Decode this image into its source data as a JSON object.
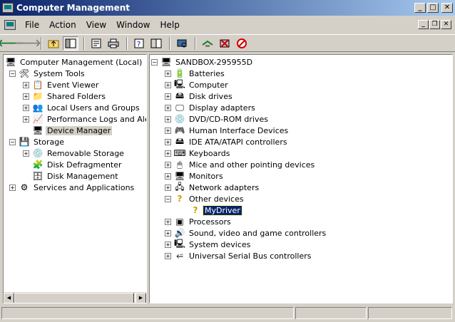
{
  "window": {
    "title": "Computer Management"
  },
  "menu": [
    "File",
    "Action",
    "View",
    "Window",
    "Help"
  ],
  "toolbar": {
    "buttons": [
      "back-icon",
      "forward-icon",
      "up-folder-icon",
      "show-hide-tree-icon",
      "properties-icon",
      "print-icon",
      "help-icon",
      "console-icon",
      "scan-hardware-icon",
      "update-driver-icon",
      "uninstall-icon",
      "disable-icon"
    ]
  },
  "left_tree": {
    "root": "Computer Management (Local)",
    "system_tools": "System Tools",
    "event_viewer": "Event Viewer",
    "shared_folders": "Shared Folders",
    "local_users": "Local Users and Groups",
    "perf_logs": "Performance Logs and Alerts",
    "device_manager": "Device Manager",
    "storage": "Storage",
    "removable_storage": "Removable Storage",
    "disk_defrag": "Disk Defragmenter",
    "disk_mgmt": "Disk Management",
    "services_apps": "Services and Applications"
  },
  "right_tree": {
    "root": "SANDBOX-295955D",
    "categories": [
      "Batteries",
      "Computer",
      "Disk drives",
      "Display adapters",
      "DVD/CD-ROM drives",
      "Human Interface Devices",
      "IDE ATA/ATAPI controllers",
      "Keyboards",
      "Mice and other pointing devices",
      "Monitors",
      "Network adapters",
      "Other devices",
      "Processors",
      "Sound, video and game controllers",
      "System devices",
      "Universal Serial Bus controllers"
    ],
    "other_device_child": "MyDriver"
  }
}
